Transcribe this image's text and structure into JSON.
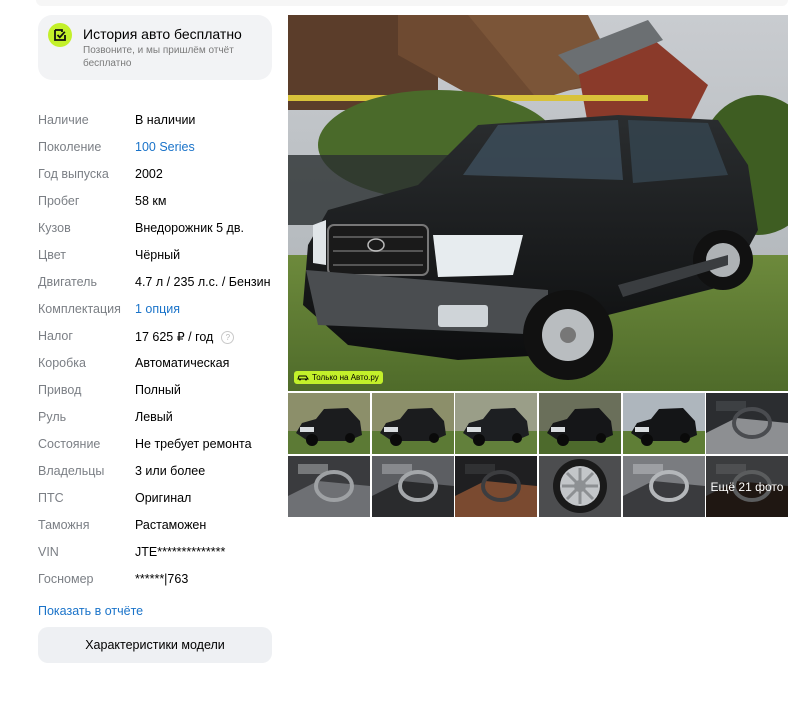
{
  "history": {
    "title": "История авто бесплатно",
    "subtitle": "Позвоните, и мы пришлём отчёт бесплатно",
    "icon": "check-badge-icon"
  },
  "specs": [
    {
      "label": "Наличие",
      "value": "В наличии",
      "link": false
    },
    {
      "label": "Поколение",
      "value": "100 Series",
      "link": true
    },
    {
      "label": "Год выпуска",
      "value": "2002",
      "link": false
    },
    {
      "label": "Пробег",
      "value": "58 км",
      "link": false
    },
    {
      "label": "Кузов",
      "value": "Внедорожник 5 дв.",
      "link": false
    },
    {
      "label": "Цвет",
      "value": "Чёрный",
      "link": false
    },
    {
      "label": "Двигатель",
      "value": "4.7 л / 235 л.с. / Бензин",
      "link": false
    },
    {
      "label": "Комплектация",
      "value": "1 опция",
      "link": true
    },
    {
      "label": "Налог",
      "value": "17 625 ₽ / год",
      "link": false,
      "help": true
    },
    {
      "label": "Коробка",
      "value": "Автоматическая",
      "link": false
    },
    {
      "label": "Привод",
      "value": "Полный",
      "link": false
    },
    {
      "label": "Руль",
      "value": "Левый",
      "link": false
    },
    {
      "label": "Состояние",
      "value": "Не требует ремонта",
      "link": false
    },
    {
      "label": "Владельцы",
      "value": "3 или более",
      "link": false
    },
    {
      "label": "ПТС",
      "value": "Оригинал",
      "link": false
    },
    {
      "label": "Таможня",
      "value": "Растаможен",
      "link": false
    },
    {
      "label": "VIN",
      "value": "JTE**************",
      "link": false
    },
    {
      "label": "Госномер",
      "value": "******|763",
      "link": false
    }
  ],
  "help_glyph": "?",
  "report_link": "Показать в отчёте",
  "model_button": "Характеристики модели",
  "gallery": {
    "badge": "Только на Авто.ру",
    "more_label": "Ещё 21 фото",
    "thumbs": [
      "exterior-front",
      "exterior-front",
      "exterior-rear",
      "exterior-top",
      "exterior-side",
      "interior-cabin",
      "interior-seats",
      "interior-steering",
      "interior-dash",
      "wheel-rim",
      "interior-door",
      "interior-door-more"
    ]
  },
  "colors": {
    "accent": "#c3f02a",
    "link": "#1a73c9",
    "muted": "#7b7f85"
  }
}
